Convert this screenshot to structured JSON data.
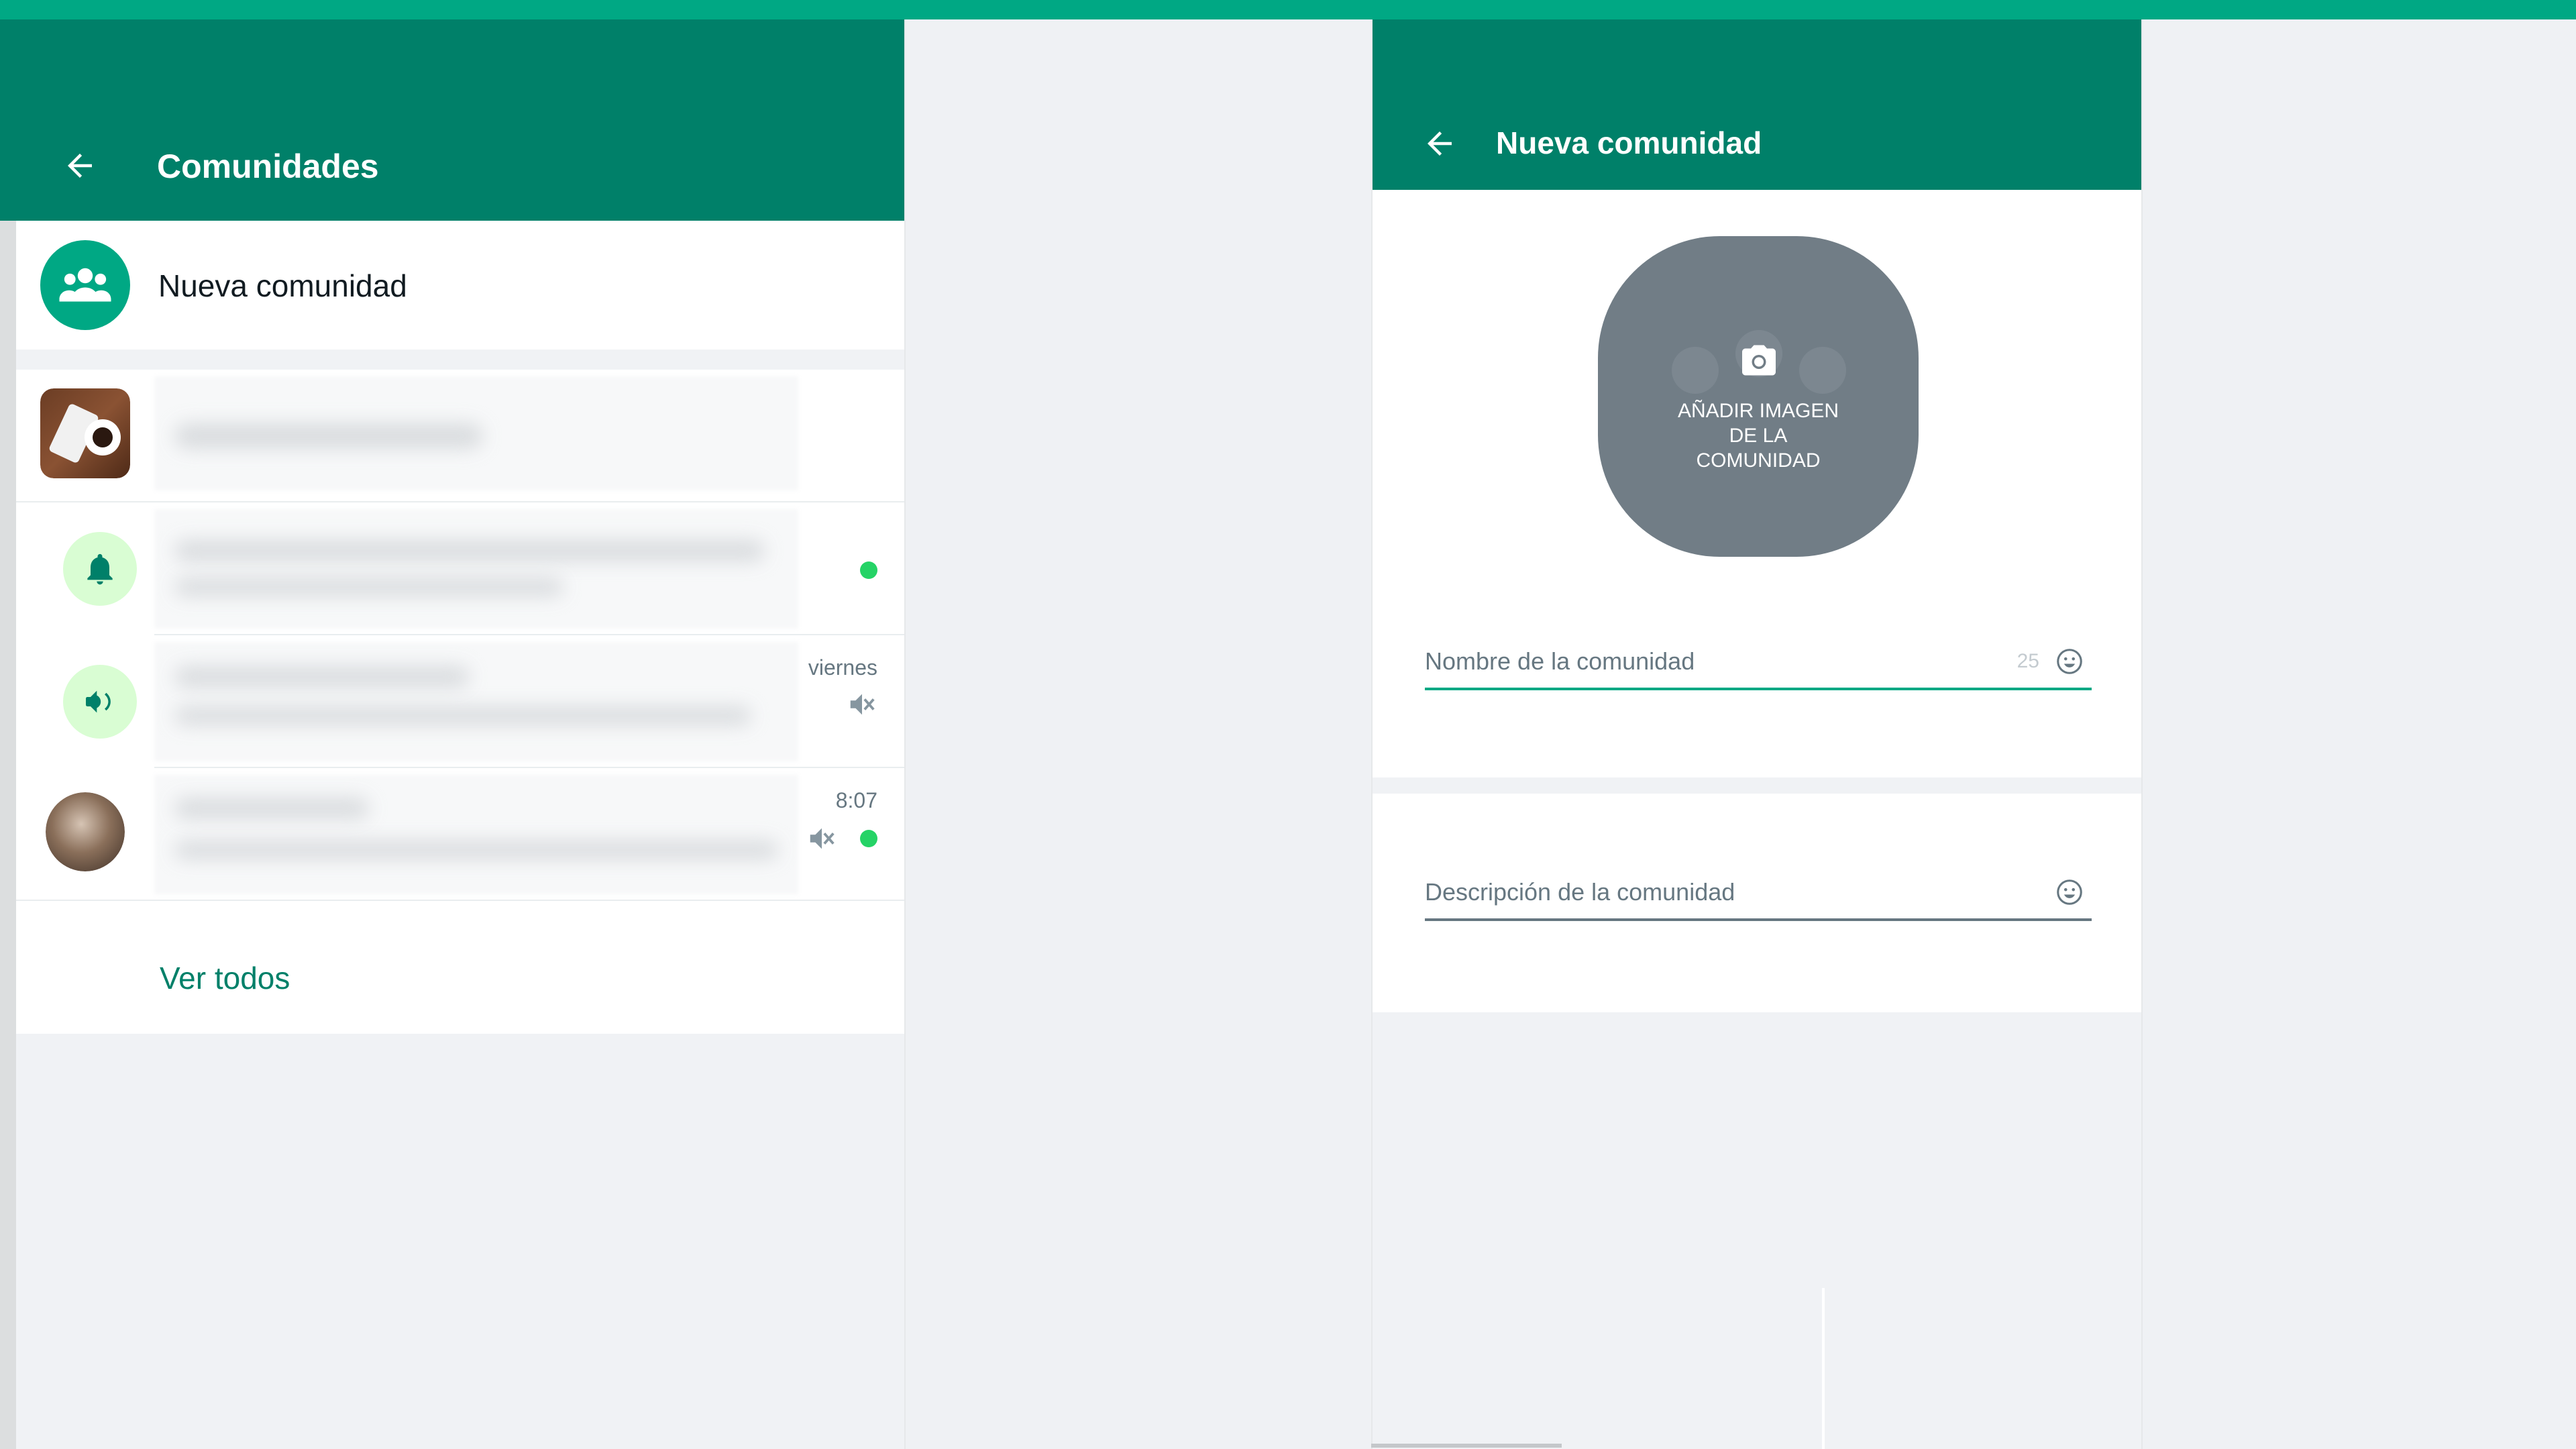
{
  "left_panel": {
    "title": "Comunidades",
    "new_community_label": "Nueva comunidad",
    "rows": [
      {
        "kind": "community",
        "time": "",
        "unread": false,
        "muted": false
      },
      {
        "kind": "announcements",
        "time": "",
        "unread": true,
        "muted": false
      },
      {
        "kind": "megaphone",
        "time": "viernes",
        "unread": false,
        "muted": true
      },
      {
        "kind": "contact",
        "time": "8:07",
        "unread": true,
        "muted": true
      }
    ],
    "see_all_label": "Ver todos"
  },
  "right_panel": {
    "title": "Nueva comunidad",
    "image_picker_label": "AÑADIR IMAGEN DE LA COMUNIDAD",
    "image_picker_lines": [
      "AÑADIR IMAGEN",
      "DE LA",
      "COMUNIDAD"
    ],
    "name_field": {
      "placeholder": "Nombre de la comunidad",
      "char_counter": "25"
    },
    "description_field": {
      "placeholder": "Descripción de la comunidad"
    }
  },
  "colors": {
    "header": "#008069",
    "accent": "#00a884",
    "unread": "#25d366",
    "background": "#f0f2f5"
  },
  "icons": [
    "back-arrow-icon",
    "community-group-icon",
    "bell-icon",
    "megaphone-icon",
    "muted-speaker-icon",
    "camera-icon",
    "emoji-icon"
  ]
}
